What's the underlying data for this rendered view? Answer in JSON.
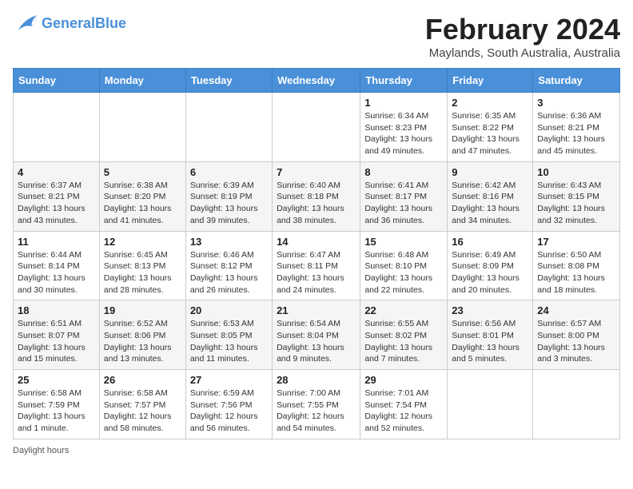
{
  "logo": {
    "line1": "General",
    "line2": "Blue"
  },
  "header": {
    "title": "February 2024",
    "subtitle": "Maylands, South Australia, Australia"
  },
  "columns": [
    "Sunday",
    "Monday",
    "Tuesday",
    "Wednesday",
    "Thursday",
    "Friday",
    "Saturday"
  ],
  "weeks": [
    [
      {
        "day": "",
        "info": ""
      },
      {
        "day": "",
        "info": ""
      },
      {
        "day": "",
        "info": ""
      },
      {
        "day": "",
        "info": ""
      },
      {
        "day": "1",
        "info": "Sunrise: 6:34 AM\nSunset: 8:23 PM\nDaylight: 13 hours\nand 49 minutes."
      },
      {
        "day": "2",
        "info": "Sunrise: 6:35 AM\nSunset: 8:22 PM\nDaylight: 13 hours\nand 47 minutes."
      },
      {
        "day": "3",
        "info": "Sunrise: 6:36 AM\nSunset: 8:21 PM\nDaylight: 13 hours\nand 45 minutes."
      }
    ],
    [
      {
        "day": "4",
        "info": "Sunrise: 6:37 AM\nSunset: 8:21 PM\nDaylight: 13 hours\nand 43 minutes."
      },
      {
        "day": "5",
        "info": "Sunrise: 6:38 AM\nSunset: 8:20 PM\nDaylight: 13 hours\nand 41 minutes."
      },
      {
        "day": "6",
        "info": "Sunrise: 6:39 AM\nSunset: 8:19 PM\nDaylight: 13 hours\nand 39 minutes."
      },
      {
        "day": "7",
        "info": "Sunrise: 6:40 AM\nSunset: 8:18 PM\nDaylight: 13 hours\nand 38 minutes."
      },
      {
        "day": "8",
        "info": "Sunrise: 6:41 AM\nSunset: 8:17 PM\nDaylight: 13 hours\nand 36 minutes."
      },
      {
        "day": "9",
        "info": "Sunrise: 6:42 AM\nSunset: 8:16 PM\nDaylight: 13 hours\nand 34 minutes."
      },
      {
        "day": "10",
        "info": "Sunrise: 6:43 AM\nSunset: 8:15 PM\nDaylight: 13 hours\nand 32 minutes."
      }
    ],
    [
      {
        "day": "11",
        "info": "Sunrise: 6:44 AM\nSunset: 8:14 PM\nDaylight: 13 hours\nand 30 minutes."
      },
      {
        "day": "12",
        "info": "Sunrise: 6:45 AM\nSunset: 8:13 PM\nDaylight: 13 hours\nand 28 minutes."
      },
      {
        "day": "13",
        "info": "Sunrise: 6:46 AM\nSunset: 8:12 PM\nDaylight: 13 hours\nand 26 minutes."
      },
      {
        "day": "14",
        "info": "Sunrise: 6:47 AM\nSunset: 8:11 PM\nDaylight: 13 hours\nand 24 minutes."
      },
      {
        "day": "15",
        "info": "Sunrise: 6:48 AM\nSunset: 8:10 PM\nDaylight: 13 hours\nand 22 minutes."
      },
      {
        "day": "16",
        "info": "Sunrise: 6:49 AM\nSunset: 8:09 PM\nDaylight: 13 hours\nand 20 minutes."
      },
      {
        "day": "17",
        "info": "Sunrise: 6:50 AM\nSunset: 8:08 PM\nDaylight: 13 hours\nand 18 minutes."
      }
    ],
    [
      {
        "day": "18",
        "info": "Sunrise: 6:51 AM\nSunset: 8:07 PM\nDaylight: 13 hours\nand 15 minutes."
      },
      {
        "day": "19",
        "info": "Sunrise: 6:52 AM\nSunset: 8:06 PM\nDaylight: 13 hours\nand 13 minutes."
      },
      {
        "day": "20",
        "info": "Sunrise: 6:53 AM\nSunset: 8:05 PM\nDaylight: 13 hours\nand 11 minutes."
      },
      {
        "day": "21",
        "info": "Sunrise: 6:54 AM\nSunset: 8:04 PM\nDaylight: 13 hours\nand 9 minutes."
      },
      {
        "day": "22",
        "info": "Sunrise: 6:55 AM\nSunset: 8:02 PM\nDaylight: 13 hours\nand 7 minutes."
      },
      {
        "day": "23",
        "info": "Sunrise: 6:56 AM\nSunset: 8:01 PM\nDaylight: 13 hours\nand 5 minutes."
      },
      {
        "day": "24",
        "info": "Sunrise: 6:57 AM\nSunset: 8:00 PM\nDaylight: 13 hours\nand 3 minutes."
      }
    ],
    [
      {
        "day": "25",
        "info": "Sunrise: 6:58 AM\nSunset: 7:59 PM\nDaylight: 13 hours\nand 1 minute."
      },
      {
        "day": "26",
        "info": "Sunrise: 6:58 AM\nSunset: 7:57 PM\nDaylight: 12 hours\nand 58 minutes."
      },
      {
        "day": "27",
        "info": "Sunrise: 6:59 AM\nSunset: 7:56 PM\nDaylight: 12 hours\nand 56 minutes."
      },
      {
        "day": "28",
        "info": "Sunrise: 7:00 AM\nSunset: 7:55 PM\nDaylight: 12 hours\nand 54 minutes."
      },
      {
        "day": "29",
        "info": "Sunrise: 7:01 AM\nSunset: 7:54 PM\nDaylight: 12 hours\nand 52 minutes."
      },
      {
        "day": "",
        "info": ""
      },
      {
        "day": "",
        "info": ""
      }
    ]
  ],
  "footer": {
    "daylight_label": "Daylight hours"
  }
}
